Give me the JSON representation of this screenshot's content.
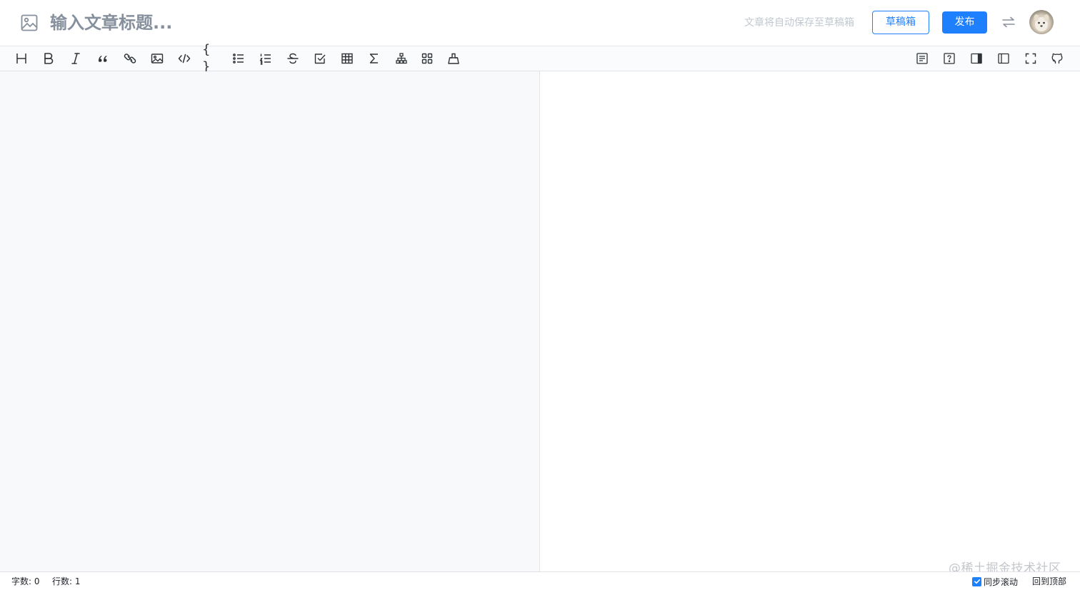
{
  "header": {
    "cover_icon": "image-icon",
    "title_placeholder": "输入文章标题...",
    "title_value": "",
    "autosave_tip": "文章将自动保存至草稿箱",
    "draft_label": "草稿箱",
    "publish_label": "发布",
    "switch_icon": "switch-arrows-icon",
    "avatar_icon": "user-avatar"
  },
  "toolbar": {
    "left_tools": [
      {
        "name": "heading",
        "icon": "heading-icon"
      },
      {
        "name": "bold",
        "icon": "bold-icon"
      },
      {
        "name": "italic",
        "icon": "italic-icon"
      },
      {
        "name": "quote",
        "icon": "quote-icon"
      },
      {
        "name": "link",
        "icon": "link-icon"
      },
      {
        "name": "image",
        "icon": "image-icon"
      },
      {
        "name": "code",
        "icon": "code-icon"
      },
      {
        "name": "code-block",
        "icon": "code-block-icon"
      },
      {
        "name": "unordered-list",
        "icon": "unordered-list-icon"
      },
      {
        "name": "ordered-list",
        "icon": "ordered-list-icon"
      },
      {
        "name": "strikethrough",
        "icon": "strikethrough-icon"
      },
      {
        "name": "task-list",
        "icon": "checkbox-icon"
      },
      {
        "name": "table",
        "icon": "table-icon"
      },
      {
        "name": "formula",
        "icon": "sigma-icon"
      },
      {
        "name": "diagram",
        "icon": "diagram-icon"
      },
      {
        "name": "plugins",
        "icon": "grid-icon"
      },
      {
        "name": "theme",
        "icon": "clean-icon"
      }
    ],
    "right_tools": [
      {
        "name": "toc",
        "icon": "toc-icon"
      },
      {
        "name": "help",
        "icon": "help-icon"
      },
      {
        "name": "preview-only",
        "icon": "preview-pane-icon"
      },
      {
        "name": "write-only",
        "icon": "write-pane-icon"
      },
      {
        "name": "fullscreen",
        "icon": "fullscreen-icon"
      },
      {
        "name": "github",
        "icon": "github-icon"
      }
    ]
  },
  "editor": {
    "content": ""
  },
  "statusbar": {
    "words_label": "字数: 0",
    "lines_label": "行数: 1",
    "sync_scroll_label": "同步滚动",
    "sync_scroll_checked": true,
    "back_to_top_label": "回到顶部"
  },
  "watermark": "@稀土掘金技术社区",
  "colors": {
    "accent": "#1e80ff",
    "editor_bg": "#f8f9fa",
    "toolbar_bg": "#fafbfc",
    "placeholder": "#86909c"
  }
}
